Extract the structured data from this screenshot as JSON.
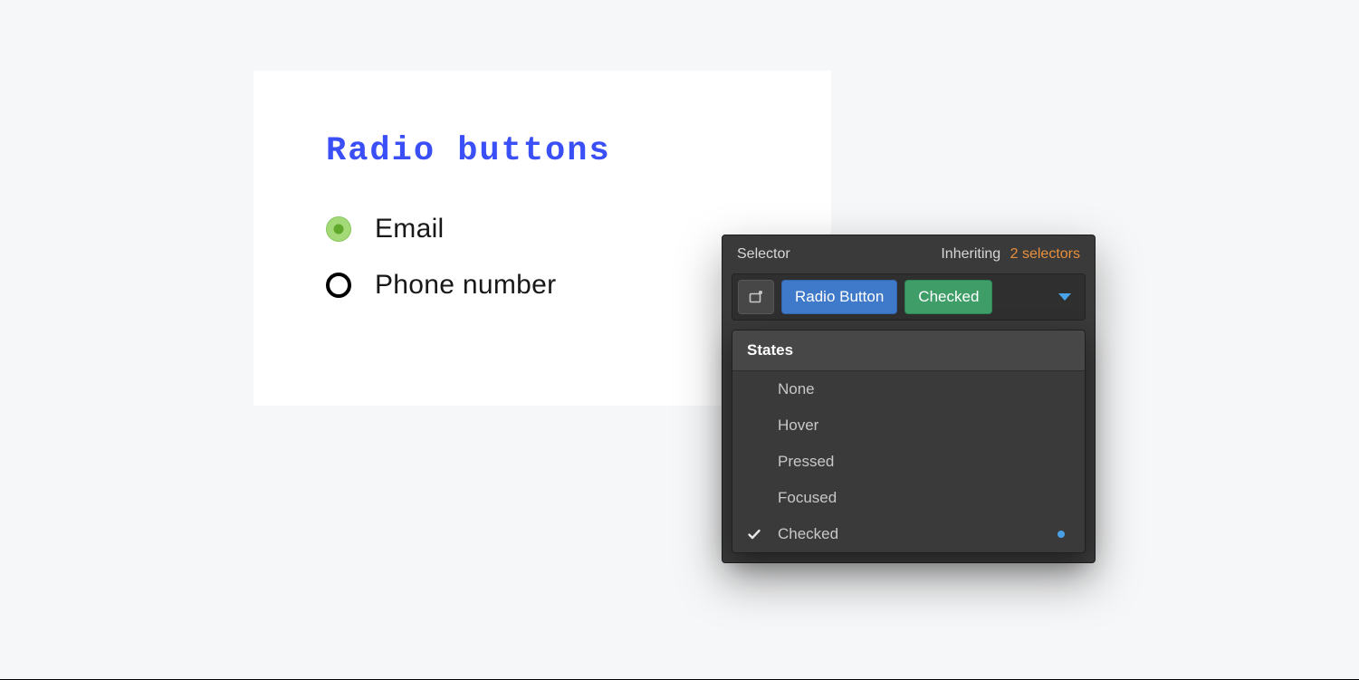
{
  "card": {
    "title": "Radio buttons",
    "options": [
      {
        "label": "Email",
        "checked": true
      },
      {
        "label": "Phone number",
        "checked": false
      }
    ]
  },
  "panel": {
    "header_left": "Selector",
    "header_right_prefix": "Inheriting",
    "header_right_accent": "2 selectors",
    "tags": {
      "class": "Radio Button",
      "state": "Checked"
    },
    "dropdown": {
      "title": "States",
      "items": [
        {
          "label": "None",
          "checked": false,
          "dot": false
        },
        {
          "label": "Hover",
          "checked": false,
          "dot": false
        },
        {
          "label": "Pressed",
          "checked": false,
          "dot": false
        },
        {
          "label": "Focused",
          "checked": false,
          "dot": false
        },
        {
          "label": "Checked",
          "checked": true,
          "dot": true
        }
      ]
    }
  }
}
